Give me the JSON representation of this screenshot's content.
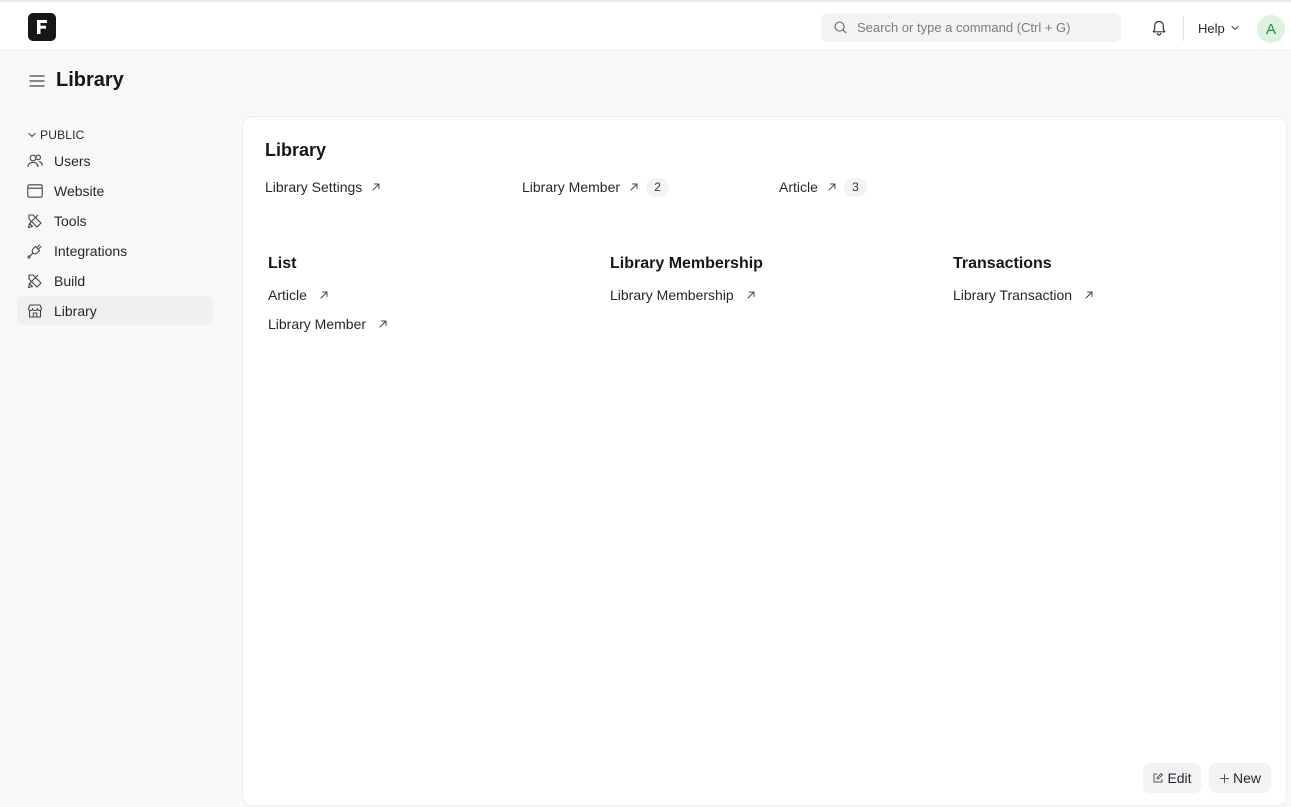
{
  "navbar": {
    "search_placeholder": "Search or type a command (Ctrl + G)",
    "help_label": "Help",
    "avatar_initial": "A"
  },
  "page": {
    "title": "Library"
  },
  "sidebar": {
    "section_label": "PUBLIC",
    "items": [
      {
        "label": "Users",
        "icon": "users-icon"
      },
      {
        "label": "Website",
        "icon": "browser-window-icon"
      },
      {
        "label": "Tools",
        "icon": "tools-icon"
      },
      {
        "label": "Integrations",
        "icon": "plug-icon"
      },
      {
        "label": "Build",
        "icon": "build-tools-icon"
      },
      {
        "label": "Library",
        "icon": "store-icon",
        "active": true
      }
    ]
  },
  "card": {
    "title": "Library",
    "shortcuts": [
      {
        "label": "Library Settings",
        "count": null
      },
      {
        "label": "Library Member",
        "count": "2"
      },
      {
        "label": "Article",
        "count": "3"
      }
    ],
    "groups": [
      {
        "title": "List",
        "links": [
          "Article",
          "Library Member"
        ]
      },
      {
        "title": "Library Membership",
        "links": [
          "Library Membership"
        ]
      },
      {
        "title": "Transactions",
        "links": [
          "Library Transaction"
        ]
      }
    ]
  },
  "actions": {
    "edit_label": "Edit",
    "new_label": "New"
  },
  "colors": {
    "active_item_bg": "#f0f0f0",
    "avatar_bg": "#dcf3e0",
    "avatar_text": "#2c8a44",
    "logo_bg": "#171717"
  }
}
